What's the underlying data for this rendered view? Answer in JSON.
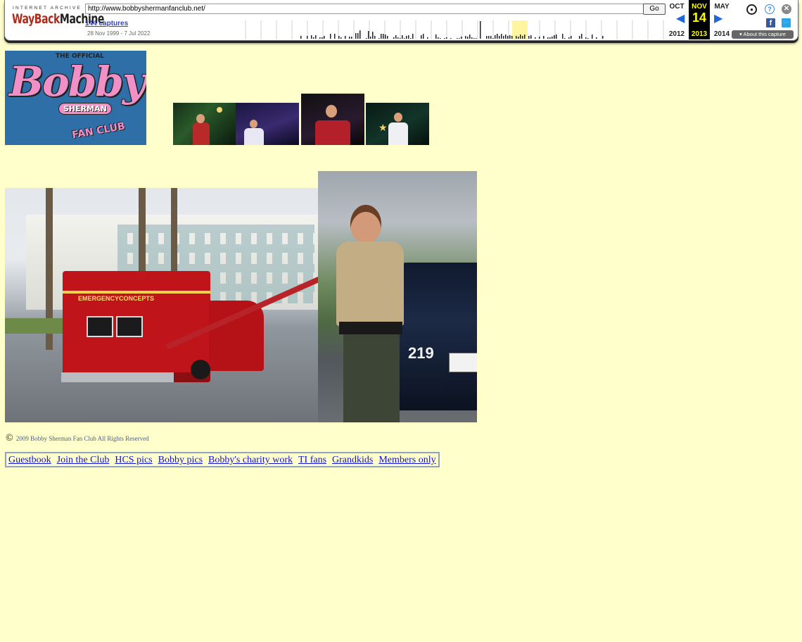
{
  "wayback": {
    "logo_top": "INTERNET ARCHIVE",
    "logo_wayback": "WayBack",
    "logo_machine": "Machine",
    "url": "http://www.bobbyshermanfanclub.net/",
    "go_label": "Go",
    "captures_label": "144 captures",
    "date_range": "28 Nov 1999 - 7 Jul 2022",
    "calendar": {
      "prev_month": "OCT",
      "prev_year": "2012",
      "cur_month": "NOV",
      "cur_day": "14",
      "cur_year": "2013",
      "next_month": "MAY",
      "next_year": "2014"
    },
    "about_label": "About this capture",
    "icons": {
      "user": "user-icon",
      "help": "help-icon",
      "close": "close-icon",
      "facebook": "facebook-icon",
      "twitter": "twitter-icon"
    },
    "accent_color": "#ffff00"
  },
  "header": {
    "logo_official": "THE OFFICIAL",
    "logo_bobby": "Bobby",
    "logo_sherman": "SHERMAN",
    "logo_fanclub": "FAN CLUB"
  },
  "photos": {
    "ambulance_sign_1": "EMERGENCY",
    "ambulance_sign_2": "CONCEPTS",
    "officer_plate": "219"
  },
  "footer": {
    "copyright": "2009 Bobby Sherman Fan Club All Rights Reserved"
  },
  "nav": {
    "links": [
      "Guestbook",
      "Join the Club",
      "HCS pics",
      "Bobby pics",
      "Bobby's charity work",
      "TI fans",
      "Grandkids",
      "Members only"
    ]
  }
}
